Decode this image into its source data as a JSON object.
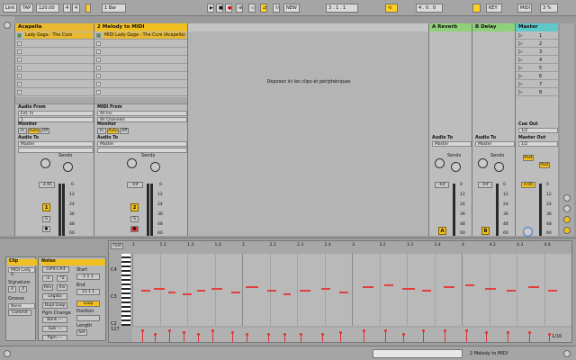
{
  "toolbar": {
    "link": "Link",
    "tap": "TAP",
    "tempo": "120.00",
    "sig_num": "4",
    "sig_den": "4",
    "quant": "1 Bar",
    "new_label": "NEW",
    "position": "3 . 1 . 1",
    "loop_start": "1 . 1 . 1",
    "loop_len": "4 . 0 . 0",
    "key": "KEY",
    "midi": "MIDI",
    "cpu": "3 %"
  },
  "tracks": [
    {
      "name": "Acapella",
      "color": "#e8b830",
      "clip": "Lady Gaga - The Cure (Acapella)",
      "clip_color": "#e8b830",
      "input_label": "Audio From",
      "input": "Ext. In",
      "input_ch": "1",
      "monitor": "Monitor",
      "mon_in": "In",
      "mon_auto": "Auto",
      "mon_off": "Off",
      "out_label": "Audio To",
      "out": "Master",
      "sends": "Sends",
      "volume": "-3.95",
      "num": "1",
      "scale": [
        "0",
        "12",
        "24",
        "36",
        "48",
        "60"
      ]
    },
    {
      "name": "2 Melody to MIDI",
      "color": "#f0c020",
      "clip": "MIDI Lady Gaga - The Cure (Acapella)",
      "clip_color": "#e8b830",
      "input_label": "MIDI From",
      "input": "All Ins",
      "input_ch": "All Channels",
      "monitor": "Monitor",
      "mon_in": "In",
      "mon_auto": "Auto",
      "mon_off": "Off",
      "out_label": "Audio To",
      "out": "Master",
      "sends": "Sends",
      "volume": "-Inf",
      "num": "2",
      "scale": [
        "0",
        "12",
        "24",
        "36",
        "48",
        "60"
      ]
    }
  ],
  "drop_text": "Déposez ici les clips et périphériques",
  "returns": [
    {
      "name": "A Reverb",
      "color": "#8fd07a",
      "out_label": "Audio To",
      "out": "Master",
      "sends": "Sends",
      "volume": "-Inf",
      "letter": "A",
      "scale": [
        "0",
        "12",
        "24",
        "36",
        "48",
        "60"
      ]
    },
    {
      "name": "B Delay",
      "color": "#8fd07a",
      "out_label": "Audio To",
      "out": "Master",
      "sends": "Sends",
      "volume": "-Inf",
      "letter": "B",
      "scale": [
        "0",
        "12",
        "24",
        "36",
        "48",
        "60"
      ]
    }
  ],
  "master": {
    "name": "Master",
    "color": "#5fc8c8",
    "scenes": [
      "1",
      "2",
      "3",
      "4",
      "5",
      "6",
      "7",
      "8"
    ],
    "cue_label": "Cue Out",
    "cue": "1/2",
    "out_label": "Master Out",
    "out": "1/2",
    "post": "Post",
    "volume": "0.00",
    "scale": [
      "0",
      "12",
      "24",
      "36",
      "48",
      "60"
    ]
  },
  "clip_view": {
    "clip_title": "Clip",
    "clip_name": "MIDI Lady G",
    "sig_label": "Signature",
    "sig_num": "4",
    "sig_den": "4",
    "groove_label": "Groove",
    "groove": "None",
    "commit": "Commit",
    "notes_title": "Notes",
    "range": "G#0-C#4",
    "start_label": "Start",
    "start": "1 1 1",
    "end_label": "End",
    "end": "13 1 1",
    "rev": "Rev",
    "inv": "Inv",
    "legato": "Legato",
    "dupl": "Dupl.Loop",
    "loop": "Loop",
    "pgm_label": "Pgm Change",
    "bank": "Bank ---",
    "sub": "Sub ---",
    "pgm": "Pgm ---",
    "position_label": "Position",
    "length_label": "Length",
    "set": "Set",
    "fold": "Fold",
    "c4": "C4",
    "c3": "C3",
    "c2": "C2",
    "vel_label": "127",
    "page": "1/16"
  },
  "ruler": [
    "1",
    "1.2",
    "1.3",
    "1.4",
    "2",
    "2.2",
    "2.3",
    "2.4",
    "3",
    "3.2",
    "3.3",
    "3.4",
    "4",
    "4.2",
    "4.3",
    "4.4"
  ],
  "status": {
    "track": "2 Melody to MIDI"
  }
}
